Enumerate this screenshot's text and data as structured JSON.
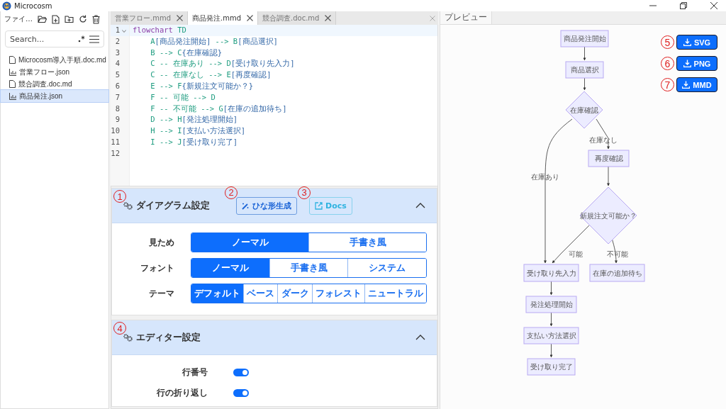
{
  "window": {
    "title": "Microcosm"
  },
  "sidebar": {
    "title": "ファイ…",
    "search": {
      "placeholder": "Search..."
    },
    "files": [
      {
        "name": "Microcosm導入手順.doc.md",
        "kind": "doc",
        "selected": false
      },
      {
        "name": "営業フロー.json",
        "kind": "chart",
        "selected": false
      },
      {
        "name": "競合調査.doc.md",
        "kind": "doc",
        "selected": false
      },
      {
        "name": "商品発注.json",
        "kind": "chart",
        "selected": true
      }
    ]
  },
  "editor_tabs": [
    {
      "label": "営業フロー.mmd",
      "selected": false
    },
    {
      "label": "商品発注.mmd",
      "selected": true
    },
    {
      "label": "競合調査.doc.md",
      "selected": false
    }
  ],
  "code_lines": [
    {
      "number": "1",
      "text": "flowchart TD"
    },
    {
      "number": "2",
      "text": "    A[商品発注開始] --> B[商品選択]"
    },
    {
      "number": "3",
      "text": "    B --> C{在庫確認}"
    },
    {
      "number": "4",
      "text": "    C -- 在庫あり --> D[受け取り先入力]"
    },
    {
      "number": "5",
      "text": "    C -- 在庫なし --> E[再度確認]"
    },
    {
      "number": "6",
      "text": "    E --> F{新規注文可能か？}"
    },
    {
      "number": "7",
      "text": "    F -- 可能 --> D"
    },
    {
      "number": "8",
      "text": "    F -- 不可能 --> G[在庫の追加待ち]"
    },
    {
      "number": "9",
      "text": "    D --> H[発注処理開始]"
    },
    {
      "number": "10",
      "text": "    H --> I[支払い方法選択]"
    },
    {
      "number": "11",
      "text": "    I --> J[受け取り完了]"
    },
    {
      "number": "12"
    }
  ],
  "diagram_settings": {
    "marker": "1",
    "title": "ダイアグラム設定",
    "expanded": true,
    "template_button": {
      "marker": "2",
      "label": "ひな形生成"
    },
    "docs_button": {
      "marker": "3",
      "label": "Docs"
    },
    "rows": [
      {
        "label": "見ため",
        "options": [
          {
            "label": "ノーマル",
            "selected": true
          },
          {
            "label": "手書き風",
            "selected": false
          }
        ]
      },
      {
        "label": "フォント",
        "options": [
          {
            "label": "ノーマル",
            "selected": true
          },
          {
            "label": "手書き風",
            "selected": false
          },
          {
            "label": "システム",
            "selected": false
          }
        ]
      },
      {
        "label": "テーマ",
        "options": [
          {
            "label": "デフォルト",
            "selected": true
          },
          {
            "label": "ベース",
            "selected": false
          },
          {
            "label": "ダーク",
            "selected": false
          },
          {
            "label": "フォレスト",
            "selected": false
          },
          {
            "label": "ニュートラル",
            "selected": false
          }
        ]
      }
    ]
  },
  "editor_settings": {
    "marker": "4",
    "title": "エディター設定",
    "expanded": true,
    "toggles": [
      {
        "label": "行番号",
        "on": true
      },
      {
        "label": "行の折り返し",
        "on": true
      }
    ]
  },
  "preview": {
    "tab": "プレビュー",
    "export_buttons": [
      {
        "marker": "5",
        "label": "SVG"
      },
      {
        "marker": "6",
        "label": "PNG"
      },
      {
        "marker": "7",
        "label": "MMD"
      }
    ],
    "nodes": [
      {
        "label": "商品発注開始",
        "kind": "rect"
      },
      {
        "label": "商品選択",
        "kind": "rect"
      },
      {
        "label": "在庫確認",
        "kind": "diamond"
      },
      {
        "label": "再度確認",
        "kind": "rect"
      },
      {
        "label": "新規注文可能か？",
        "kind": "diamond"
      },
      {
        "label": "受け取り先入力",
        "kind": "rect"
      },
      {
        "label": "在庫の追加待ち",
        "kind": "rect"
      },
      {
        "label": "発注処理開始",
        "kind": "rect"
      },
      {
        "label": "支払い方法選択",
        "kind": "rect"
      },
      {
        "label": "受け取り完了",
        "kind": "rect"
      }
    ],
    "edge_labels": [
      "在庫あり",
      "在庫なし",
      "可能",
      "不可能"
    ]
  }
}
